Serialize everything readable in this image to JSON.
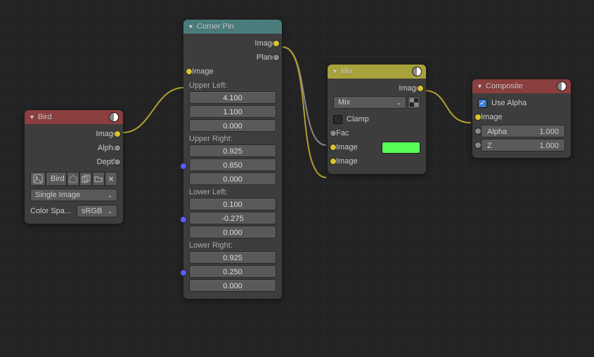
{
  "nodes": {
    "bird": {
      "title": "Bird",
      "outputs": {
        "image": "Image",
        "alpha": "Alpha",
        "depth": "Depth"
      },
      "file_name": "Bird",
      "source": "Single Image",
      "colorspace_label": "Color Spa...",
      "colorspace_value": "sRGB"
    },
    "cornerpin": {
      "title": "Corner Pin",
      "outputs": {
        "image": "Image",
        "plane": "Plane"
      },
      "input_image": "Image",
      "ul_label": "Upper Left:",
      "ul": [
        "4.100",
        "1.100",
        "0.000"
      ],
      "ur_label": "Upper Right:",
      "ur": [
        "0.925",
        "0.850",
        "0.000"
      ],
      "ll_label": "Lower Left:",
      "ll": [
        "0.100",
        "-0.275",
        "0.000"
      ],
      "lr_label": "Lower Right:",
      "lr": [
        "0.925",
        "0.250",
        "0.000"
      ]
    },
    "mix": {
      "title": "Mix",
      "output_image": "Image",
      "blend_mode": "Mix",
      "clamp_label": "Clamp",
      "fac_label": "Fac",
      "image1_label": "Image",
      "image2_label": "Image",
      "color": "#57ff57"
    },
    "composite": {
      "title": "Composite",
      "use_alpha_label": "Use Alpha",
      "input_image": "Image",
      "alpha_label": "Alpha",
      "alpha_value": "1.000",
      "z_label": "Z",
      "z_value": "1.000"
    }
  }
}
